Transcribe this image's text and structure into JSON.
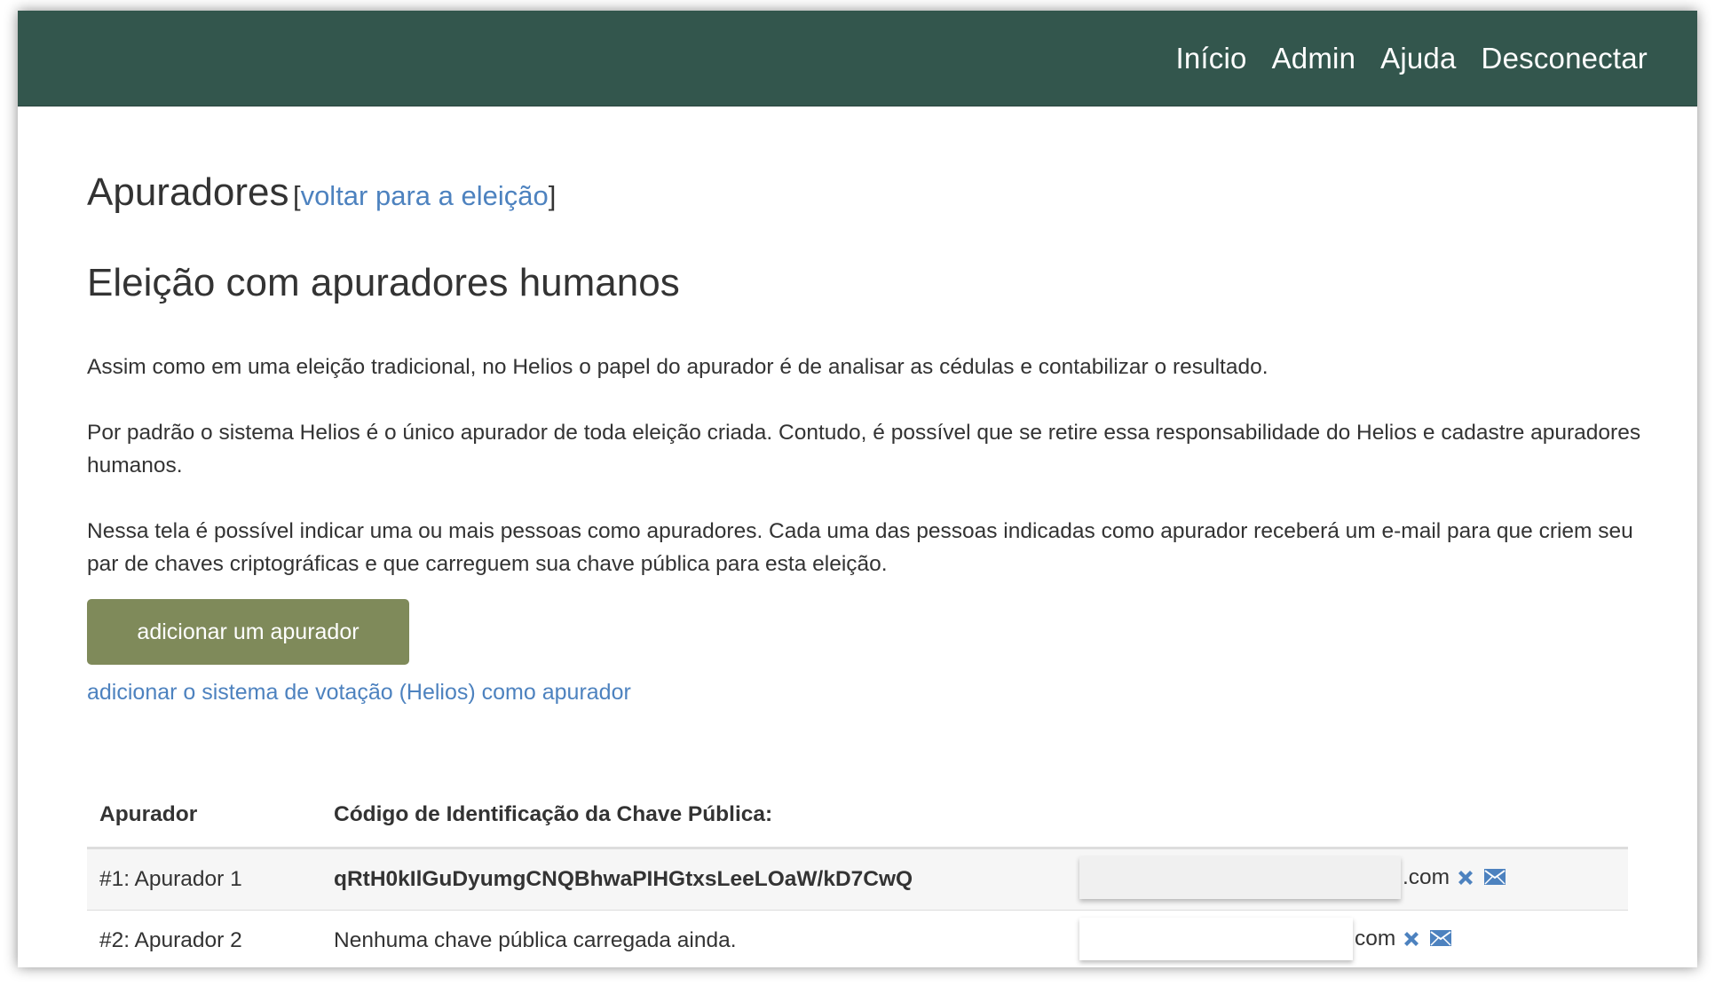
{
  "nav": {
    "items": [
      "Início",
      "Admin",
      "Ajuda",
      "Desconectar"
    ]
  },
  "page": {
    "title": "Apuradores",
    "bracket_open": "[",
    "back_link": "voltar para a eleição",
    "bracket_close": "]",
    "subtitle": "Eleição com apuradores humanos",
    "paragraphs": [
      "Assim como em uma eleição tradicional, no Helios o papel do apurador é de analisar as cédulas e contabilizar o resultado.",
      "Por padrão o sistema Helios é o único apurador de toda eleição criada. Contudo, é possível que se retire essa responsabilidade do Helios e cadastre apuradores humanos.",
      "Nessa tela é possível indicar uma ou mais pessoas como apuradores. Cada uma das pessoas indicadas como apurador receberá um e-mail para que criem seu par de chaves criptográficas e que carreguem sua chave pública para esta eleição."
    ],
    "add_button": "adicionar um apurador",
    "add_helios_link": "adicionar o sistema de votação (Helios) como apurador"
  },
  "table": {
    "headers": [
      "Apurador",
      "Código de Identificação da Chave Pública:"
    ],
    "rows": [
      {
        "name": "#1: Apurador 1",
        "key": "qRtH0kIlGuDyumgCNQBhwaPIHGtxsLeeLOaW/kD7CwQ",
        "email_suffix": ".com"
      },
      {
        "name": "#2: Apurador 2",
        "key": "Nenhuma chave pública carregada ainda.",
        "email_suffix": "com"
      }
    ]
  },
  "colors": {
    "navbar": "#33564d",
    "button": "#7f8a5a",
    "link": "#4d82bf",
    "icon": "#4d82bf"
  },
  "icons": [
    "close-icon",
    "envelope-icon"
  ]
}
